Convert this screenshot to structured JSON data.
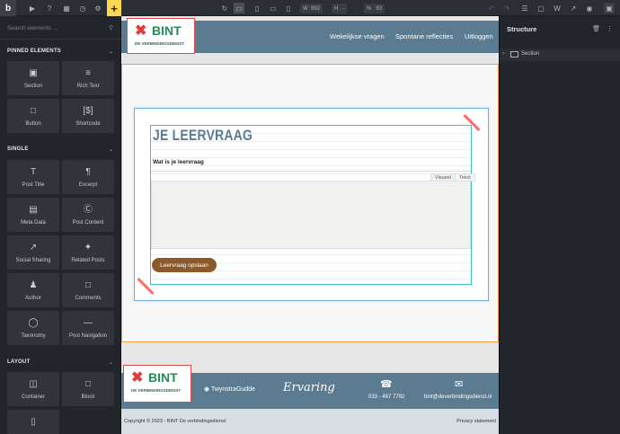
{
  "toolbar": {
    "logo": "b",
    "width_label": "W",
    "width_value": "992",
    "height_label": "H",
    "height_value": "-",
    "zoom_label": "%",
    "zoom_value": "93",
    "add_symbol": "+"
  },
  "left_panel": {
    "search_placeholder": "Search elements ...",
    "pinned_title": "PINNED ELEMENTS",
    "pinned_items": [
      {
        "label": "Section",
        "icon": "section-icon"
      },
      {
        "label": "Rich Text",
        "icon": "rich-text-icon"
      },
      {
        "label": "Button",
        "icon": "button-icon"
      },
      {
        "label": "Shortcode",
        "icon": "shortcode-icon"
      }
    ],
    "single_title": "SINGLE",
    "single_items": [
      {
        "label": "Post Title",
        "icon": "post-title-icon"
      },
      {
        "label": "Excerpt",
        "icon": "excerpt-icon"
      },
      {
        "label": "Meta Data",
        "icon": "meta-data-icon"
      },
      {
        "label": "Post Content",
        "icon": "wordpress-icon"
      },
      {
        "label": "Social Sharing",
        "icon": "share-icon"
      },
      {
        "label": "Related Posts",
        "icon": "pin-icon"
      },
      {
        "label": "Author",
        "icon": "user-icon"
      },
      {
        "label": "Comments",
        "icon": "comment-icon"
      },
      {
        "label": "Taxonomy",
        "icon": "tag-icon"
      },
      {
        "label": "Post Navigation",
        "icon": "navigation-icon"
      }
    ],
    "layout_title": "LAYOUT",
    "layout_items": [
      {
        "label": "Container",
        "icon": "container-icon"
      },
      {
        "label": "Block",
        "icon": "block-icon"
      }
    ]
  },
  "site": {
    "logo_text": "BINT",
    "logo_sub": "DE VERBINDINGSDIENST",
    "nav": [
      "Wekelijkse vragen",
      "Spontane reflecties",
      "Uitloggen"
    ],
    "form_title": "JE LEERVRAAG",
    "question_label": "Wat is je leervraag",
    "tab_visual": "Visueel",
    "tab_text": "Tekst",
    "save_button": "Leervraag opslaan",
    "footer_twynstra": "TwynstraGudde",
    "footer_signature": "Ervaring",
    "footer_phone": "033 - 467 7792",
    "footer_email": "bint@deverbindingsdienst.nl",
    "copyright": "Copyright © 2023 - BINT De verbindingsdienst",
    "privacy": "Privacy statement"
  },
  "right_panel": {
    "title": "Structure",
    "tree": [
      {
        "label": "Section"
      }
    ]
  }
}
